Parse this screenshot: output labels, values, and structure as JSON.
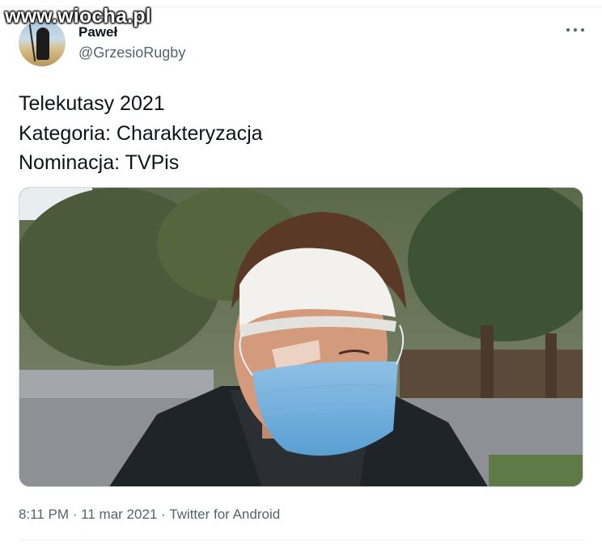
{
  "watermark": "www.wiocha.pl",
  "author": {
    "display_name": "Paweł",
    "handle": "@GrzesioRugby",
    "avatar_icon": "grim-reaper-avatar"
  },
  "more_icon": "ellipsis-icon",
  "tweet": {
    "lines": [
      "Telekutasy 2021",
      "Kategoria: Charakteryzacja",
      "Nominacja: TVPis"
    ]
  },
  "media": {
    "description_icon": "photo-man-with-bandaged-head-and-face-mask"
  },
  "meta": {
    "time": "8:11 PM",
    "date": "11 mar 2021",
    "source": "Twitter for Android",
    "separator": " · "
  },
  "colors": {
    "text": "#0f1419",
    "secondary": "#536471",
    "border": "#cfd9de"
  }
}
